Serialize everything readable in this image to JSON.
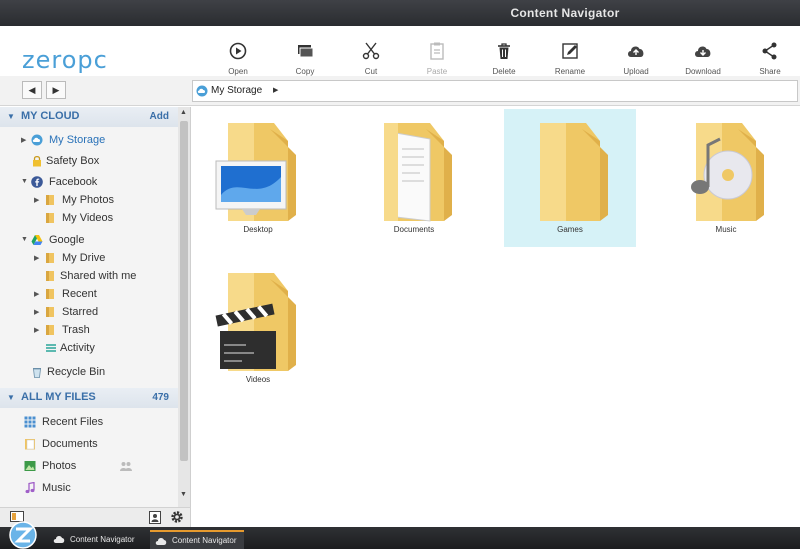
{
  "window": {
    "title": "Content Navigator"
  },
  "logo": "zeropc",
  "toolbar": [
    {
      "label": "Open",
      "icon": "play-circle-icon",
      "enabled": true
    },
    {
      "label": "Copy",
      "icon": "copy-icon",
      "enabled": true
    },
    {
      "label": "Cut",
      "icon": "scissors-icon",
      "enabled": true
    },
    {
      "label": "Paste",
      "icon": "clipboard-icon",
      "enabled": false
    },
    {
      "label": "Delete",
      "icon": "trash-icon",
      "enabled": true
    },
    {
      "label": "Rename",
      "icon": "pencil-icon",
      "enabled": true
    },
    {
      "label": "Upload",
      "icon": "cloud-upload-icon",
      "enabled": true
    },
    {
      "label": "Download",
      "icon": "cloud-download-icon",
      "enabled": true
    },
    {
      "label": "Share",
      "icon": "share-icon",
      "enabled": true
    }
  ],
  "nav": {
    "back": "◀",
    "forward": "▶",
    "path": "My Storage",
    "path_arrow": "▶"
  },
  "sidebar": {
    "my_cloud": {
      "title": "MY CLOUD",
      "action": "Add",
      "items": [
        {
          "label": "My Storage",
          "selected": true
        },
        {
          "label": "Safety Box"
        },
        {
          "label": "Facebook"
        },
        {
          "label": "My Photos"
        },
        {
          "label": "My Videos"
        },
        {
          "label": "Google"
        },
        {
          "label": "My Drive"
        },
        {
          "label": "Shared with me"
        },
        {
          "label": "Recent"
        },
        {
          "label": "Starred"
        },
        {
          "label": "Trash"
        },
        {
          "label": "Activity"
        },
        {
          "label": "Recycle Bin"
        }
      ]
    },
    "all_files": {
      "title": "ALL MY FILES",
      "count": "479",
      "items": [
        {
          "label": "Recent Files"
        },
        {
          "label": "Documents"
        },
        {
          "label": "Photos"
        },
        {
          "label": "Music"
        }
      ]
    }
  },
  "folders": [
    {
      "label": "Desktop",
      "overlay": "desktop-screen",
      "selected": false
    },
    {
      "label": "Documents",
      "overlay": "documents-papers",
      "selected": false
    },
    {
      "label": "Games",
      "overlay": "none",
      "selected": true
    },
    {
      "label": "Music",
      "overlay": "music-note-cd",
      "selected": false
    },
    {
      "label": "Videos",
      "overlay": "clapperboard",
      "selected": false
    }
  ],
  "taskbar": [
    {
      "label": "Content Navigator",
      "active": false
    },
    {
      "label": "Content Navigator",
      "active": true
    }
  ],
  "colors": {
    "accent": "#3a6fa8",
    "selection": "#d6f2f7",
    "folder": "#f3cf72",
    "taskbar_active": "#e69a2e"
  }
}
